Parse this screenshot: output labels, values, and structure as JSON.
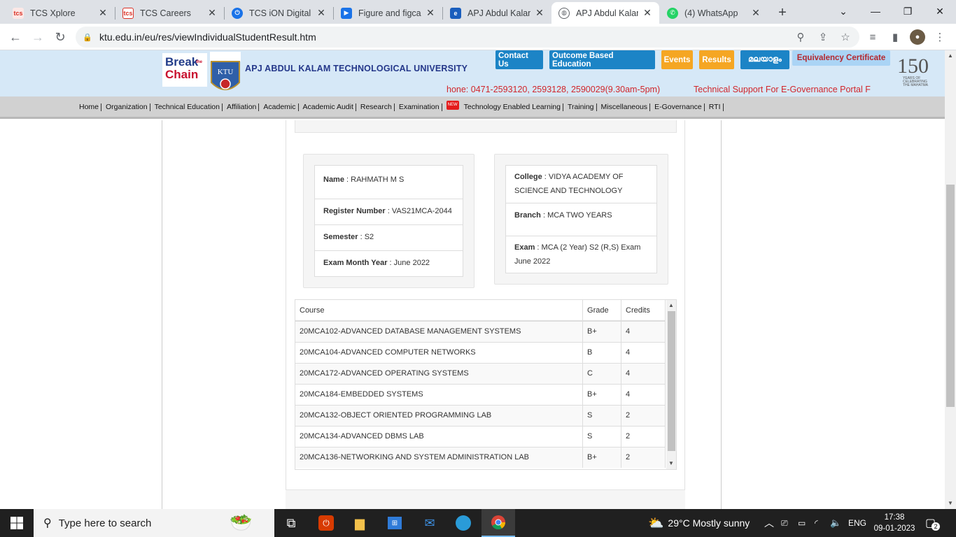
{
  "browser": {
    "tabs": [
      {
        "title": "TCS Xplore",
        "active": false
      },
      {
        "title": "TCS Careers",
        "active": false
      },
      {
        "title": "TCS iON Digital L",
        "active": false
      },
      {
        "title": "Figure and figcap",
        "active": false
      },
      {
        "title": "APJ Abdul Kalam",
        "active": false
      },
      {
        "title": "APJ Abdul Kalam",
        "active": true
      },
      {
        "title": "(4) WhatsApp",
        "active": false
      }
    ],
    "url": "ktu.edu.in/eu/res/viewIndividualStudentResult.htm"
  },
  "header": {
    "logo_text_1": "Break",
    "logo_text_the": "the",
    "logo_text_2": "Chain",
    "ktu_monogram": "KTU",
    "university": "APJ ABDUL KALAM TECHNOLOGICAL UNIVERSITY",
    "buttons": [
      {
        "label": "Contact Us",
        "color": "#1c84c6"
      },
      {
        "label": "Outcome Based Education",
        "color": "#1c84c6"
      },
      {
        "label": "Events",
        "color": "#f5a623"
      },
      {
        "label": "Results",
        "color": "#f5a623"
      },
      {
        "label": "മലയാളം",
        "color": "#1c84c6"
      },
      {
        "label": "Equivalency Certificate",
        "color": "#aad4f5"
      }
    ],
    "ticker_phone": "hone: 0471-2593120, 2593128, 2590029(9.30am-5pm)",
    "ticker_support": "Technical Support For E-Governance Portal F",
    "anniversary": "150",
    "anniversary_caption": "YEARS OF CELEBRATING THE MAHATMA"
  },
  "menu": {
    "items": [
      "Home",
      "Organization",
      "Technical Education",
      "Affiliation",
      "Academic",
      "Academic Audit",
      "Research",
      "Examination",
      "Technology Enabled Learning",
      "Training",
      "Miscellaneous",
      "E-Governance",
      "RTI"
    ],
    "new_badge": "NEW"
  },
  "student": {
    "name_label": "Name",
    "name": "RAHMATH M S",
    "register_label": "Register Number",
    "register": "VAS21MCA-2044",
    "semester_label": "Semester",
    "semester": "S2",
    "exam_month_label": "Exam Month Year",
    "exam_month": "June 2022",
    "college_label": "College",
    "college": "VIDYA ACADEMY OF SCIENCE AND TECHNOLOGY",
    "branch_label": "Branch",
    "branch": "MCA TWO YEARS",
    "exam_label": "Exam",
    "exam": "MCA (2 Year) S2 (R,S) Exam June 2022"
  },
  "results": {
    "headers": [
      "Course",
      "Grade",
      "Credits"
    ],
    "rows": [
      {
        "course": "20MCA102-ADVANCED DATABASE MANAGEMENT SYSTEMS",
        "grade": "B+",
        "credits": "4"
      },
      {
        "course": "20MCA104-ADVANCED COMPUTER NETWORKS",
        "grade": "B",
        "credits": "4"
      },
      {
        "course": "20MCA172-ADVANCED OPERATING SYSTEMS",
        "grade": "C",
        "credits": "4"
      },
      {
        "course": "20MCA184-EMBEDDED SYSTEMS",
        "grade": "B+",
        "credits": "4"
      },
      {
        "course": "20MCA132-OBJECT ORIENTED PROGRAMMING LAB",
        "grade": "S",
        "credits": "2"
      },
      {
        "course": "20MCA134-ADVANCED DBMS LAB",
        "grade": "S",
        "credits": "2"
      },
      {
        "course": "20MCA136-NETWORKING AND SYSTEM ADMINISTRATION LAB",
        "grade": "B+",
        "credits": "2"
      }
    ]
  },
  "taskbar": {
    "search_placeholder": "Type here to search",
    "weather": "29°C  Mostly sunny",
    "lang": "ENG",
    "time": "17:38",
    "date": "09-01-2023",
    "notifications": "2"
  }
}
